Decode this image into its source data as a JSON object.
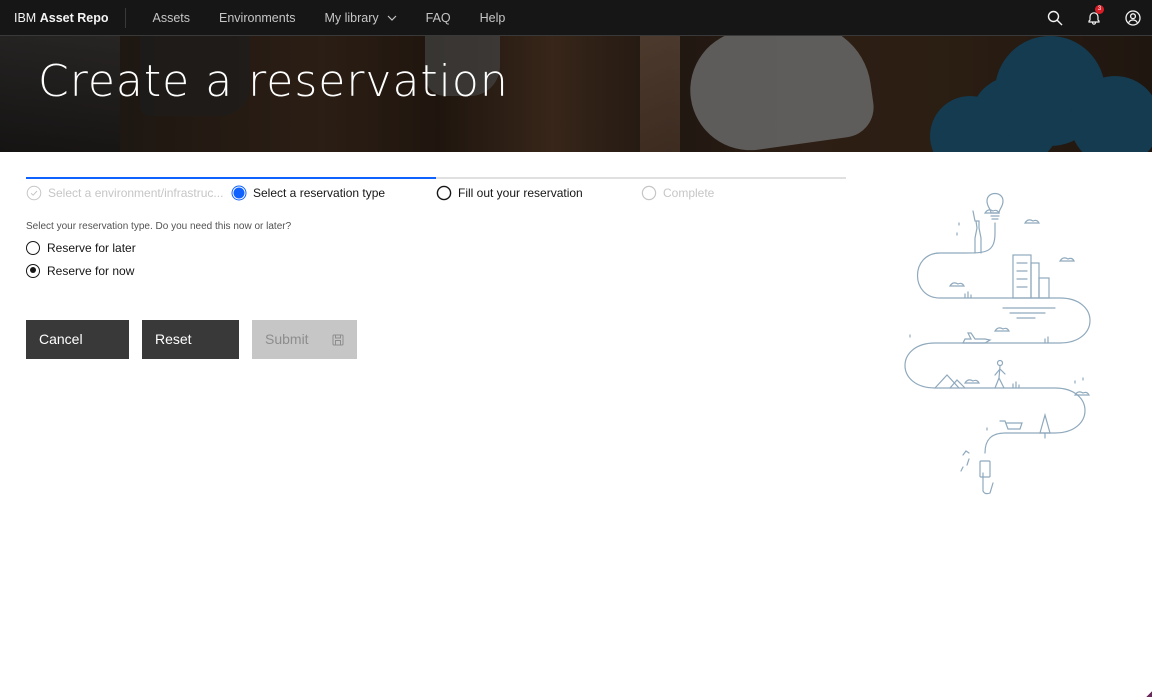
{
  "app": {
    "brand_prefix": "IBM",
    "brand_name": "Asset Repo"
  },
  "nav": {
    "items": [
      {
        "label": "Assets"
      },
      {
        "label": "Environments"
      },
      {
        "label": "My library",
        "has_dropdown": true
      },
      {
        "label": "FAQ"
      },
      {
        "label": "Help"
      }
    ],
    "actions": {
      "search_icon": "search-icon",
      "notification_icon": "bell-icon",
      "notification_count": "3",
      "user_icon": "user-avatar-icon"
    }
  },
  "hero": {
    "title": "Create a reservation"
  },
  "progress": {
    "steps": [
      {
        "label": "Select a environment/infrastruc...",
        "state": "complete"
      },
      {
        "label": "Select a reservation type",
        "state": "current"
      },
      {
        "label": "Fill out your reservation",
        "state": "incomplete"
      },
      {
        "label": "Complete",
        "state": "disabled"
      }
    ]
  },
  "form": {
    "question": "Select your reservation type. Do you need this now or later?",
    "options": [
      {
        "label": "Reserve for later",
        "checked": false
      },
      {
        "label": "Reserve for now",
        "checked": true
      }
    ]
  },
  "buttons": {
    "cancel": "Cancel",
    "reset": "Reset",
    "submit": "Submit",
    "submit_icon": "save-icon",
    "submit_disabled": true
  },
  "colors": {
    "accent": "#0f62fe",
    "nav_bg": "#161616",
    "button_dark": "#393939",
    "button_disabled": "#c6c6c6",
    "badge": "#da1e28",
    "illustration_stroke": "#8fa9bd"
  }
}
